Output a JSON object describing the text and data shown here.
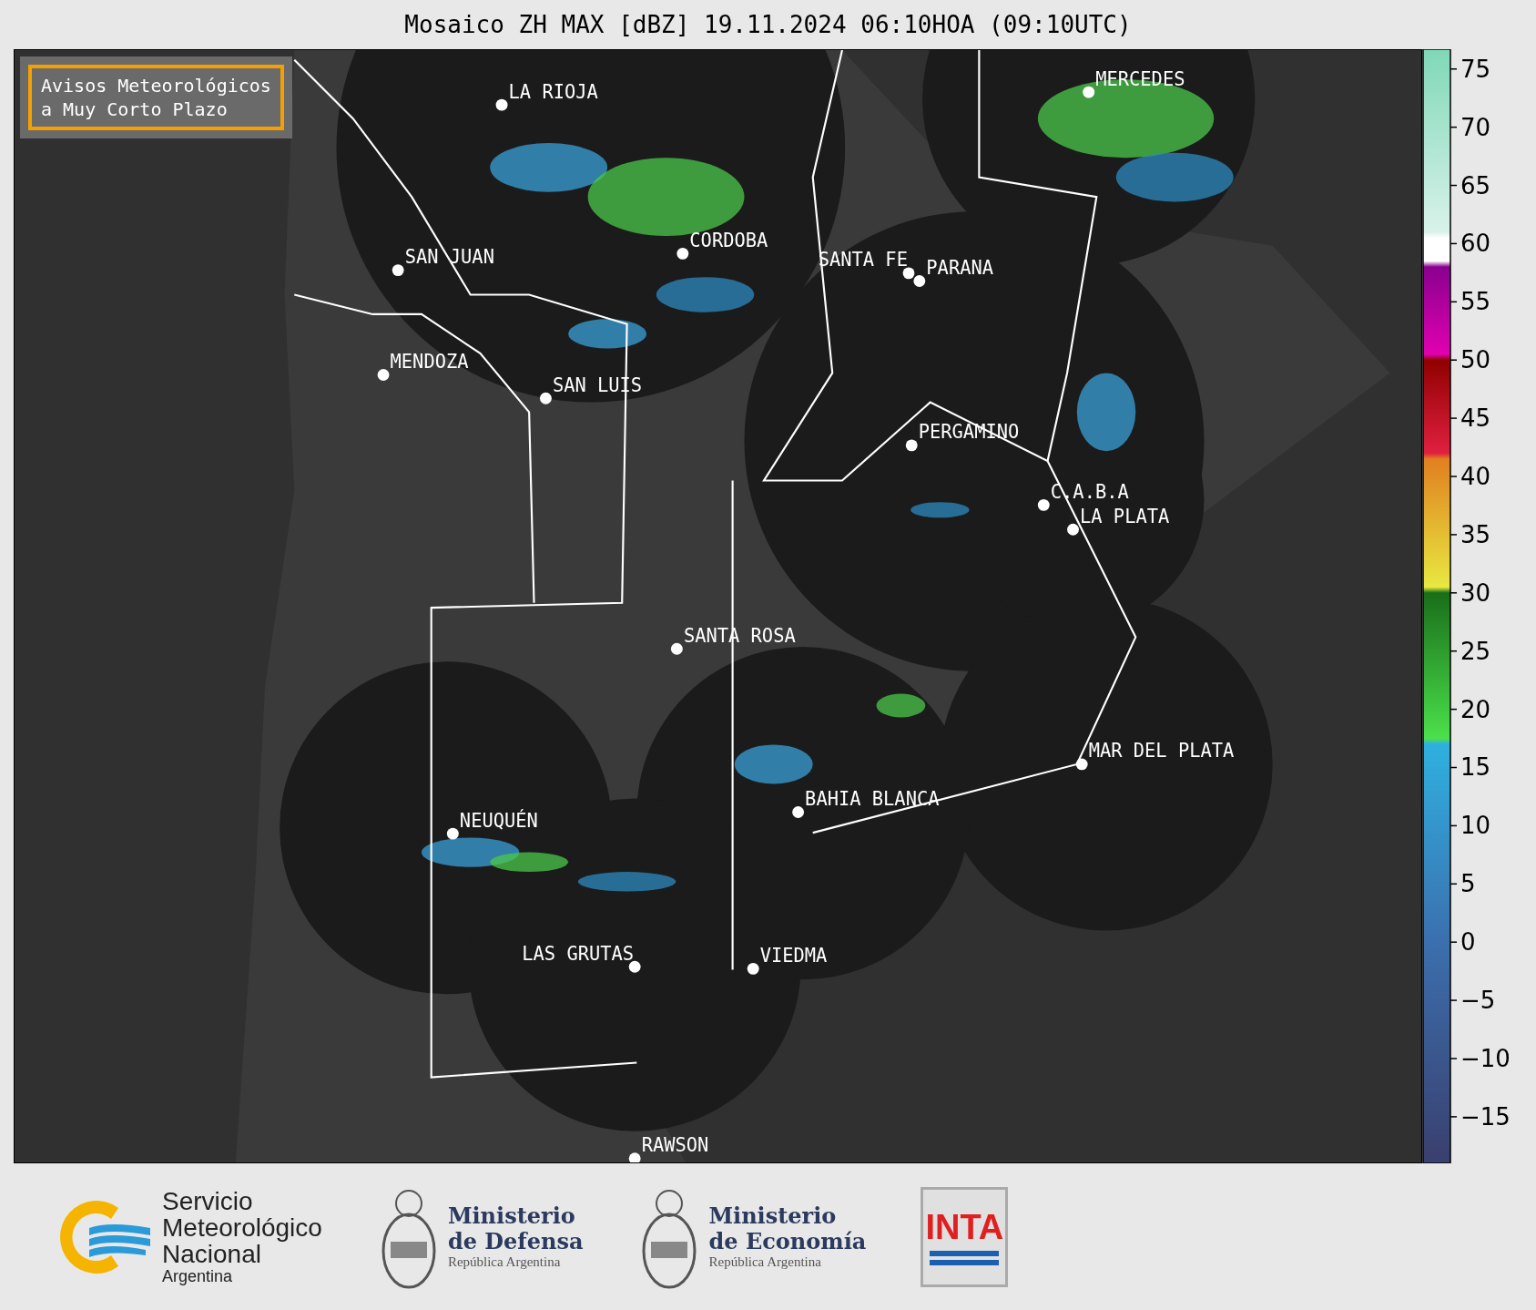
{
  "title": "Mosaico ZH MAX [dBZ] 19.11.2024 06:10HOA (09:10UTC)",
  "notice": {
    "lines": [
      "Avisos Meteorológicos",
      "a Muy Corto Plazo"
    ]
  },
  "cities": [
    {
      "name": "LA RIOJA"
    },
    {
      "name": "MERCEDES"
    },
    {
      "name": "CORDOBA"
    },
    {
      "name": "SAN JUAN"
    },
    {
      "name": "SANTA FE"
    },
    {
      "name": "PARANA"
    },
    {
      "name": "MENDOZA"
    },
    {
      "name": "SAN LUIS"
    },
    {
      "name": "PERGAMINO"
    },
    {
      "name": "C.A.B.A"
    },
    {
      "name": "LA PLATA"
    },
    {
      "name": "SANTA ROSA"
    },
    {
      "name": "MAR DEL PLATA"
    },
    {
      "name": "BAHIA BLANCA"
    },
    {
      "name": "NEUQUÉN"
    },
    {
      "name": "LAS GRUTAS"
    },
    {
      "name": "VIEDMA"
    },
    {
      "name": "RAWSON"
    }
  ],
  "colorbar": {
    "ticks": [
      "75",
      "70",
      "65",
      "60",
      "55",
      "50",
      "45",
      "40",
      "35",
      "30",
      "25",
      "20",
      "15",
      "10",
      "5",
      "0",
      "−5",
      "−10",
      "−15"
    ]
  },
  "footer": {
    "logos": [
      {
        "kind": "smn",
        "lines": [
          "Servicio",
          "Meteorológico",
          "Nacional"
        ],
        "sub": "Argentina"
      },
      {
        "kind": "ministry",
        "lines": [
          "Ministerio",
          "de Defensa"
        ],
        "sub": "República Argentina"
      },
      {
        "kind": "ministry",
        "lines": [
          "Ministerio",
          "de Economía"
        ],
        "sub": "República Argentina"
      },
      {
        "kind": "inta",
        "lines": [
          "INTA"
        ]
      }
    ]
  }
}
